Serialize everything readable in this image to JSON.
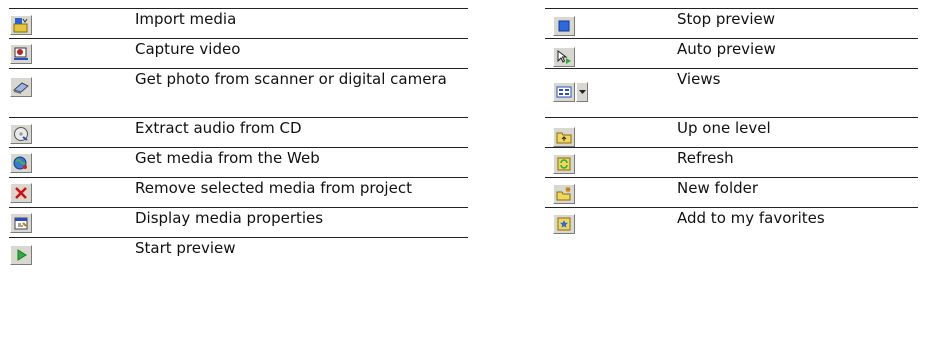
{
  "left_rows": [
    {
      "label": "Import media",
      "icon": "import-media-icon"
    },
    {
      "label": "Capture video",
      "icon": "capture-video-icon"
    },
    {
      "label": "Get photo from scanner or digital camera",
      "icon": "scanner-camera-icon"
    },
    {
      "label": "Extract audio from CD",
      "icon": "cd-audio-icon"
    },
    {
      "label": "Get media from the Web",
      "icon": "web-globe-icon"
    },
    {
      "label": "Remove selected media from project",
      "icon": "remove-x-icon"
    },
    {
      "label": "Display media properties",
      "icon": "properties-icon"
    },
    {
      "label": "Start preview",
      "icon": "play-icon"
    }
  ],
  "right_rows": [
    {
      "label": "Stop preview",
      "icon": "stop-icon"
    },
    {
      "label": "Auto preview",
      "icon": "auto-preview-icon"
    },
    {
      "label": "Views",
      "icon": "views-icon"
    },
    {
      "label": "Up one level",
      "icon": "up-folder-icon"
    },
    {
      "label": "Refresh",
      "icon": "refresh-icon"
    },
    {
      "label": "New folder",
      "icon": "new-folder-icon"
    },
    {
      "label": "Add to my favorites",
      "icon": "favorites-icon"
    }
  ],
  "colors": {
    "rule": "#222222",
    "button_face": "#d8d8d0",
    "text": "#111111"
  }
}
